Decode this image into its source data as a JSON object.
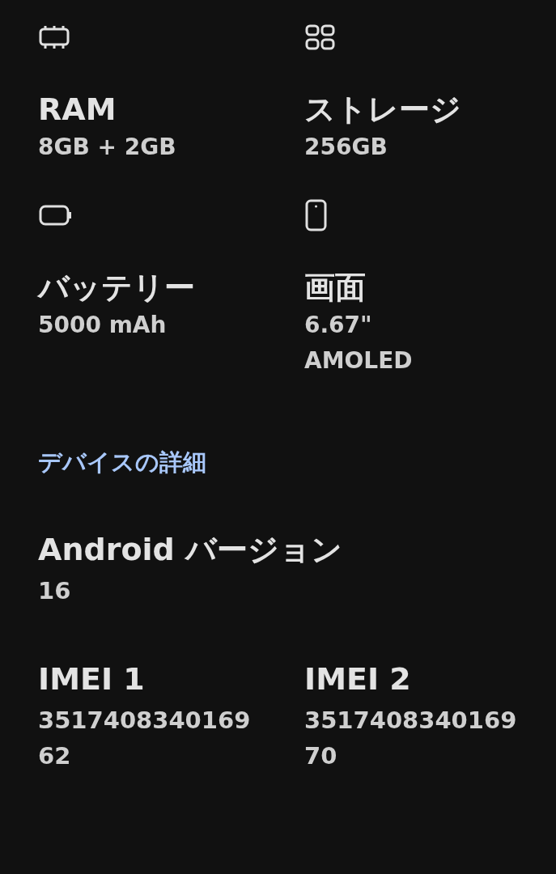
{
  "specs": [
    {
      "kind": "ram",
      "title": "RAM",
      "value": "8GB + 2GB"
    },
    {
      "kind": "storage",
      "title": "ストレージ",
      "value": "256GB"
    },
    {
      "kind": "battery",
      "title": "バッテリー",
      "value": "5000 mAh"
    },
    {
      "kind": "screen",
      "title": "画面",
      "value": "6.67\" AMOLED"
    }
  ],
  "section_title": "デバイスの詳細",
  "version": {
    "title": "Android バージョン",
    "value": "16"
  },
  "imeis": [
    {
      "title": "IMEI 1",
      "value": "351740834016962"
    },
    {
      "title": "IMEI 2",
      "value": "351740834016970"
    }
  ]
}
